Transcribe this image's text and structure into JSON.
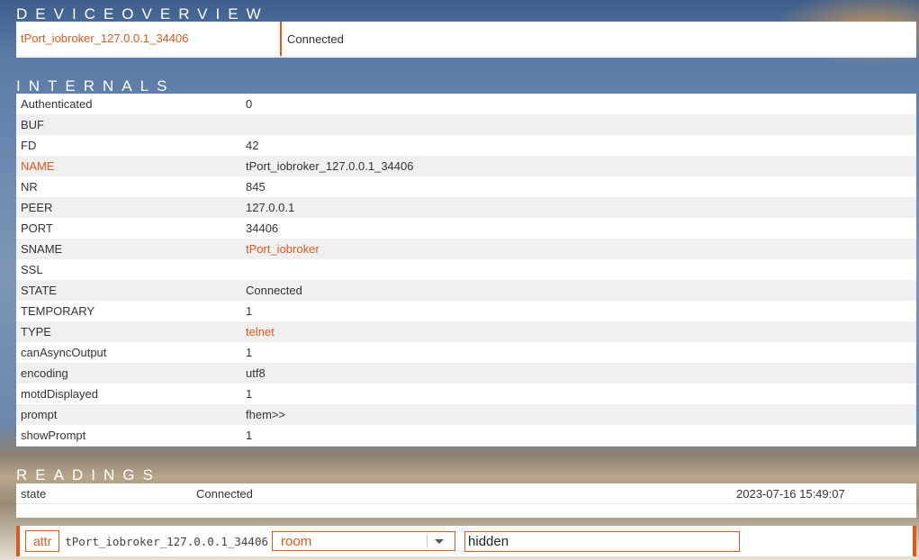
{
  "overview": {
    "title": "DEVICEOVERVIEW",
    "device_name": "tPort_iobroker_127.0.0.1_34406",
    "state": "Connected"
  },
  "internals": {
    "title": "INTERNALS",
    "rows": [
      {
        "key": "Authenticated",
        "value": "0"
      },
      {
        "key": "BUF",
        "value": ""
      },
      {
        "key": "FD",
        "value": "42"
      },
      {
        "key": "NAME",
        "value": "tPort_iobroker_127.0.0.1_34406"
      },
      {
        "key": "NR",
        "value": "845"
      },
      {
        "key": "PEER",
        "value": "127.0.0.1"
      },
      {
        "key": "PORT",
        "value": "34406"
      },
      {
        "key": "SNAME",
        "value": "tPort_iobroker"
      },
      {
        "key": "SSL",
        "value": ""
      },
      {
        "key": "STATE",
        "value": "Connected"
      },
      {
        "key": "TEMPORARY",
        "value": "1"
      },
      {
        "key": "TYPE",
        "value": "telnet"
      },
      {
        "key": "canAsyncOutput",
        "value": "1"
      },
      {
        "key": "encoding",
        "value": "utf8"
      },
      {
        "key": "motdDisplayed",
        "value": "1"
      },
      {
        "key": "prompt",
        "value": "fhem>>"
      },
      {
        "key": "showPrompt",
        "value": "1"
      }
    ]
  },
  "readings": {
    "title": "READINGS",
    "rows": [
      {
        "key": "state",
        "value": "Connected",
        "timestamp": "2023-07-16 15:49:07"
      }
    ]
  },
  "attr_bar": {
    "button_label": "attr",
    "device": "tPort_iobroker_127.0.0.1_34406",
    "selected_attr": "room",
    "value": "hidden"
  },
  "colors": {
    "accent": "#e0581c",
    "row_alt": "#f0f0f0"
  }
}
